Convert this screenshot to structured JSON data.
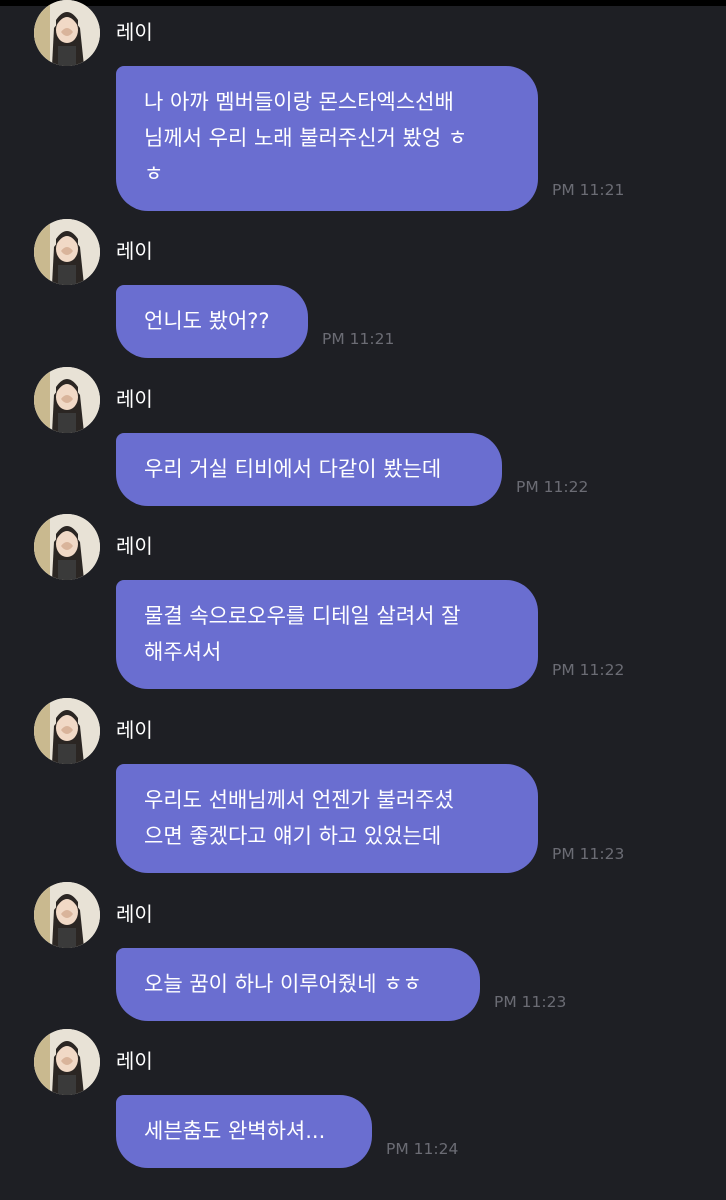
{
  "sender": "레이",
  "messages": [
    {
      "lines": [
        "나 아까 멤버들이랑 몬스타엑스선배",
        "님께서 우리 노래 불러주신거 봤엉 ㅎ",
        "ㅎ"
      ],
      "time": "PM 11:21"
    },
    {
      "lines": [
        "언니도 봤어??"
      ],
      "time": "PM 11:21"
    },
    {
      "lines": [
        "우리 거실 티비에서 다같이 봤는데"
      ],
      "time": "PM 11:22"
    },
    {
      "lines": [
        "물결 속으로오우를 디테일 살려서 잘",
        "해주셔서"
      ],
      "time": "PM 11:22"
    },
    {
      "lines": [
        "우리도 선배님께서 언젠가 불러주셨",
        "으면 좋겠다고 얘기 하고 있었는데"
      ],
      "time": "PM 11:23"
    },
    {
      "lines": [
        "오늘 꿈이 하나 이루어줬네 ㅎㅎ"
      ],
      "time": "PM 11:23"
    },
    {
      "lines": [
        "세븐춤도 완벽하셔..."
      ],
      "time": "PM 11:24"
    }
  ]
}
